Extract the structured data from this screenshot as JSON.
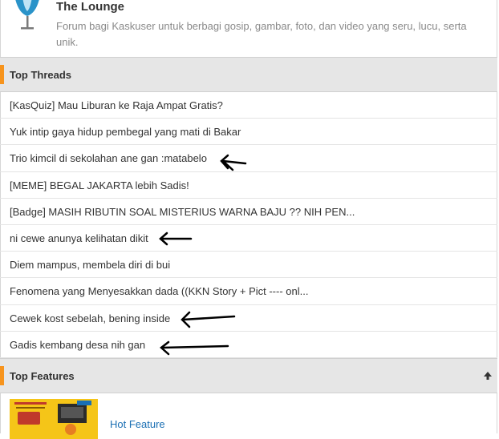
{
  "lounge": {
    "title": "The Lounge",
    "description": "Forum bagi Kaskuser untuk berbagi gosip, gambar, foto, dan video yang seru, lucu, serta unik."
  },
  "top_threads": {
    "header": "Top Threads",
    "items": [
      "[KasQuiz] Mau Liburan ke Raja Ampat Gratis?",
      "Yuk intip gaya hidup pembegal yang mati di Bakar",
      "Trio kimcil di sekolahan ane gan :matabelo",
      "[MEME] BEGAL JAKARTA lebih Sadis!",
      "[Badge] MASIH RIBUTIN SOAL MISTERIUS WARNA BAJU ?? NIH PEN...",
      "ni cewe anunya kelihatan dikit",
      "Diem mampus, membela diri di bui",
      "Fenomena yang Menyesakkan dada ((KKN Story + Pict ---- onl...",
      "Cewek kost sebelah, bening inside",
      "Gadis kembang desa nih gan"
    ]
  },
  "top_features": {
    "header": "Top Features",
    "hot_feature_label": "Hot Feature"
  },
  "colors": {
    "accent": "#f7941d",
    "link": "#1a6fb3"
  }
}
